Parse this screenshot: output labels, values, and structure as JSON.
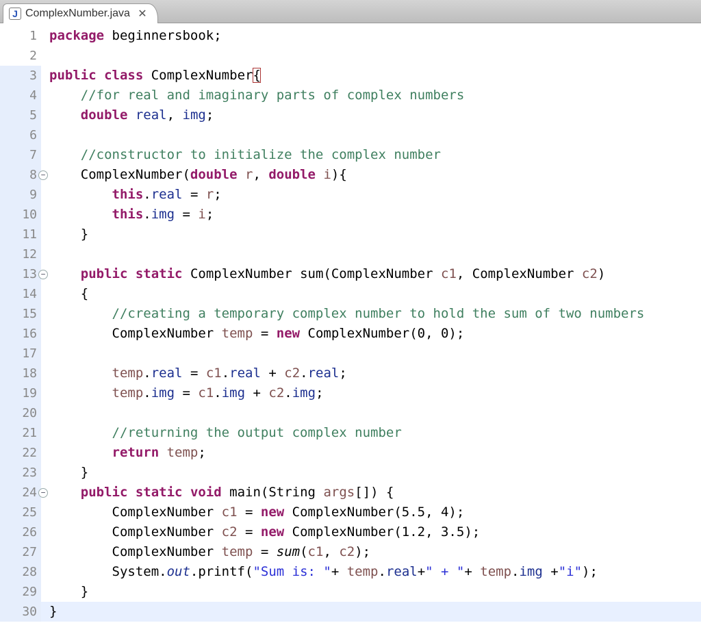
{
  "tab": {
    "filename": "ComplexNumber.java",
    "icon_label": "J",
    "close_glyph": "✕"
  },
  "gutter": {
    "count": 30,
    "fold_markers": [
      8,
      13,
      24
    ],
    "highlighted": [
      3,
      4,
      5,
      6,
      7,
      8,
      9,
      10,
      11,
      12,
      13,
      14,
      15,
      16,
      17,
      18,
      19,
      20,
      21,
      22,
      23,
      24,
      25,
      26,
      27,
      28,
      29,
      30
    ],
    "current_line": 30
  },
  "code_lines": [
    [
      [
        "kw",
        "package"
      ],
      [
        "",
        " beginnersbook;"
      ]
    ],
    [
      [
        "",
        ""
      ]
    ],
    [
      [
        "kw",
        "public"
      ],
      [
        "",
        " "
      ],
      [
        "kw",
        "class"
      ],
      [
        "",
        " ComplexNumber"
      ],
      [
        "box",
        "{"
      ]
    ],
    [
      [
        "",
        "    "
      ],
      [
        "cm",
        "//for real and imaginary parts of complex numbers"
      ]
    ],
    [
      [
        "",
        "    "
      ],
      [
        "kw",
        "double"
      ],
      [
        "",
        " "
      ],
      [
        "fld",
        "real"
      ],
      [
        "",
        ", "
      ],
      [
        "fld",
        "img"
      ],
      [
        "",
        ";"
      ]
    ],
    [
      [
        "",
        ""
      ]
    ],
    [
      [
        "",
        "    "
      ],
      [
        "cm",
        "//constructor to initialize the complex number"
      ]
    ],
    [
      [
        "",
        "    ComplexNumber("
      ],
      [
        "kw",
        "double"
      ],
      [
        "",
        " "
      ],
      [
        "id",
        "r"
      ],
      [
        "",
        ", "
      ],
      [
        "kw",
        "double"
      ],
      [
        "",
        " "
      ],
      [
        "id",
        "i"
      ],
      [
        "",
        "){"
      ]
    ],
    [
      [
        "",
        "        "
      ],
      [
        "kw",
        "this"
      ],
      [
        "",
        "."
      ],
      [
        "fld",
        "real"
      ],
      [
        "",
        " = "
      ],
      [
        "id",
        "r"
      ],
      [
        "",
        ";"
      ]
    ],
    [
      [
        "",
        "        "
      ],
      [
        "kw",
        "this"
      ],
      [
        "",
        "."
      ],
      [
        "fld",
        "img"
      ],
      [
        "",
        " = "
      ],
      [
        "id",
        "i"
      ],
      [
        "",
        ";"
      ]
    ],
    [
      [
        "",
        "    }"
      ]
    ],
    [
      [
        "",
        ""
      ]
    ],
    [
      [
        "",
        "    "
      ],
      [
        "kw",
        "public"
      ],
      [
        "",
        " "
      ],
      [
        "kw",
        "static"
      ],
      [
        "",
        " ComplexNumber sum(ComplexNumber "
      ],
      [
        "id",
        "c1"
      ],
      [
        "",
        ", ComplexNumber "
      ],
      [
        "id",
        "c2"
      ],
      [
        "",
        ")"
      ]
    ],
    [
      [
        "",
        "    {"
      ]
    ],
    [
      [
        "",
        "        "
      ],
      [
        "cm",
        "//creating a temporary complex number to hold the sum of two numbers"
      ]
    ],
    [
      [
        "",
        "        ComplexNumber "
      ],
      [
        "id",
        "temp"
      ],
      [
        "",
        " = "
      ],
      [
        "kw",
        "new"
      ],
      [
        "",
        " ComplexNumber(0, 0);"
      ]
    ],
    [
      [
        "",
        ""
      ]
    ],
    [
      [
        "",
        "        "
      ],
      [
        "id",
        "temp"
      ],
      [
        "",
        "."
      ],
      [
        "fld",
        "real"
      ],
      [
        "",
        " = "
      ],
      [
        "id",
        "c1"
      ],
      [
        "",
        "."
      ],
      [
        "fld",
        "real"
      ],
      [
        "",
        " + "
      ],
      [
        "id",
        "c2"
      ],
      [
        "",
        "."
      ],
      [
        "fld",
        "real"
      ],
      [
        "",
        ";"
      ]
    ],
    [
      [
        "",
        "        "
      ],
      [
        "id",
        "temp"
      ],
      [
        "",
        "."
      ],
      [
        "fld",
        "img"
      ],
      [
        "",
        " = "
      ],
      [
        "id",
        "c1"
      ],
      [
        "",
        "."
      ],
      [
        "fld",
        "img"
      ],
      [
        "",
        " + "
      ],
      [
        "id",
        "c2"
      ],
      [
        "",
        "."
      ],
      [
        "fld",
        "img"
      ],
      [
        "",
        ";"
      ]
    ],
    [
      [
        "",
        ""
      ]
    ],
    [
      [
        "",
        "        "
      ],
      [
        "cm",
        "//returning the output complex number"
      ]
    ],
    [
      [
        "",
        "        "
      ],
      [
        "kw",
        "return"
      ],
      [
        "",
        " "
      ],
      [
        "id",
        "temp"
      ],
      [
        "",
        ";"
      ]
    ],
    [
      [
        "",
        "    }"
      ]
    ],
    [
      [
        "",
        "    "
      ],
      [
        "kw",
        "public"
      ],
      [
        "",
        " "
      ],
      [
        "kw",
        "static"
      ],
      [
        "",
        " "
      ],
      [
        "kw",
        "void"
      ],
      [
        "",
        " main(String "
      ],
      [
        "id",
        "args"
      ],
      [
        "",
        "[]) {"
      ]
    ],
    [
      [
        "",
        "        ComplexNumber "
      ],
      [
        "id",
        "c1"
      ],
      [
        "",
        " = "
      ],
      [
        "kw",
        "new"
      ],
      [
        "",
        " ComplexNumber(5.5, 4);"
      ]
    ],
    [
      [
        "",
        "        ComplexNumber "
      ],
      [
        "id",
        "c2"
      ],
      [
        "",
        " = "
      ],
      [
        "kw",
        "new"
      ],
      [
        "",
        " ComplexNumber(1.2, 3.5);"
      ]
    ],
    [
      [
        "",
        "        ComplexNumber "
      ],
      [
        "id",
        "temp"
      ],
      [
        "",
        " = "
      ],
      [
        "italic",
        "sum"
      ],
      [
        "",
        "("
      ],
      [
        "id",
        "c1"
      ],
      [
        "",
        ", "
      ],
      [
        "id",
        "c2"
      ],
      [
        "",
        ");"
      ]
    ],
    [
      [
        "",
        "        System."
      ],
      [
        "fld italic",
        "out"
      ],
      [
        "",
        ".printf("
      ],
      [
        "str",
        "\"Sum is: \""
      ],
      [
        "",
        "+ "
      ],
      [
        "id",
        "temp"
      ],
      [
        "",
        "."
      ],
      [
        "fld",
        "real"
      ],
      [
        "",
        "+"
      ],
      [
        "str",
        "\" + \""
      ],
      [
        "",
        "+ "
      ],
      [
        "id",
        "temp"
      ],
      [
        "",
        "."
      ],
      [
        "fld",
        "img"
      ],
      [
        "",
        " +"
      ],
      [
        "str",
        "\"i\""
      ],
      [
        "",
        ");"
      ]
    ],
    [
      [
        "",
        "    }"
      ]
    ],
    [
      [
        "",
        "}"
      ]
    ]
  ]
}
